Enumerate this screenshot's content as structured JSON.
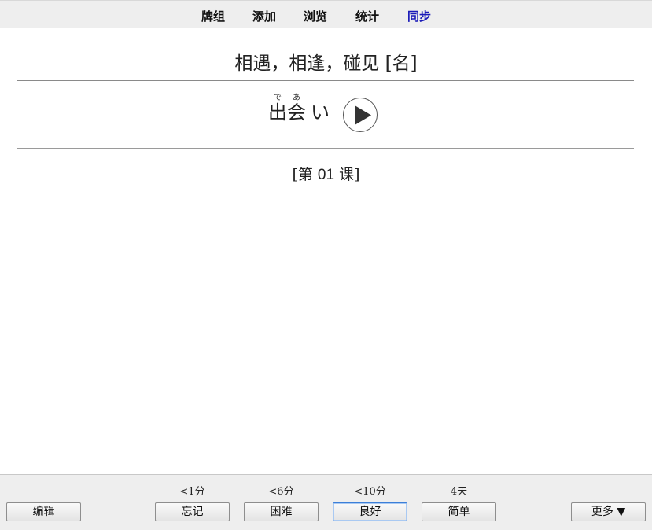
{
  "nav": {
    "decks": "牌组",
    "add": "添加",
    "browse": "浏览",
    "stats": "统计",
    "sync": "同步"
  },
  "card": {
    "meaning": "相遇，相逢，碰见 [名]",
    "word_kanji_1": "出",
    "word_reading_1": "で",
    "word_kanji_2": "会",
    "word_reading_2": "あ",
    "word_kana": "い",
    "lesson_open": "[第 ",
    "lesson_number": "01",
    "lesson_close": " 课]",
    "play_icon": "play-audio-icon"
  },
  "answer_bar": {
    "edit_label": "编辑",
    "more_label": "更多 ▼",
    "intervals": [
      "<1分",
      "<6分",
      "<10分",
      "4天"
    ],
    "buttons": [
      "忘记",
      "困难",
      "良好",
      "简单"
    ]
  }
}
